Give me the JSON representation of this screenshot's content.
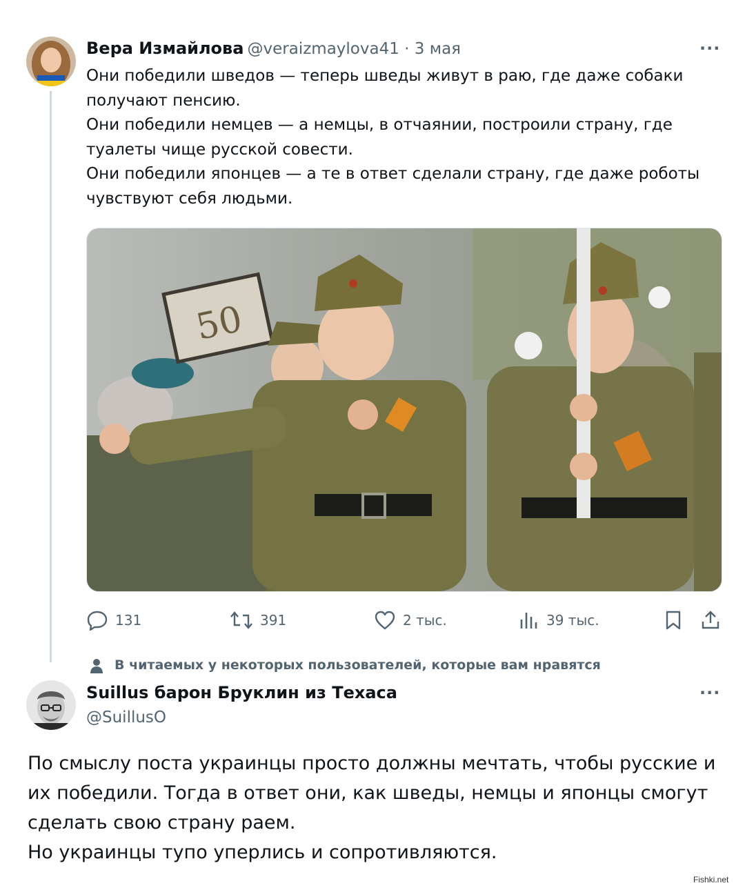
{
  "tweet1": {
    "author_name": "Вера Измайлова",
    "handle_date": "@veraizmaylova41 · 3 мая",
    "paragraphs": [
      "Они победили шведов — теперь шведы живут в раю, где даже собаки получают пенсию.",
      "Они победили немцев — а немцы, в отчаянии, построили страну, где туалеты чище русской совести.",
      "Они победили японцев — а те в ответ сделали страну, где даже роботы чувствуют себя людьми."
    ],
    "photo_sign": "50",
    "actions": {
      "replies": "131",
      "reposts": "391",
      "likes": "2 тыс.",
      "views": "39 тыс."
    },
    "more": "···"
  },
  "context_note": "В читаемых у некоторых пользователей, которые вам нравятся",
  "tweet2": {
    "author_name": "Suillus барон Бруклин из Техаса",
    "handle": "@SuillusO",
    "paragraphs": [
      "По смыслу поста украинцы просто должны мечтать, чтобы русские и их победили. Тогда в ответ они, как шведы, немцы и японцы смогут сделать свою страну раем.",
      "Но украинцы тупо уперлись и сопротивляются."
    ],
    "more": "···"
  },
  "watermark": "Fishki.net",
  "colors": {
    "secondary_text": "#536471",
    "thread_line": "#cfd9de"
  },
  "icons": [
    "reply-icon",
    "repost-icon",
    "like-icon",
    "views-icon",
    "bookmark-icon",
    "share-icon",
    "person-icon"
  ]
}
